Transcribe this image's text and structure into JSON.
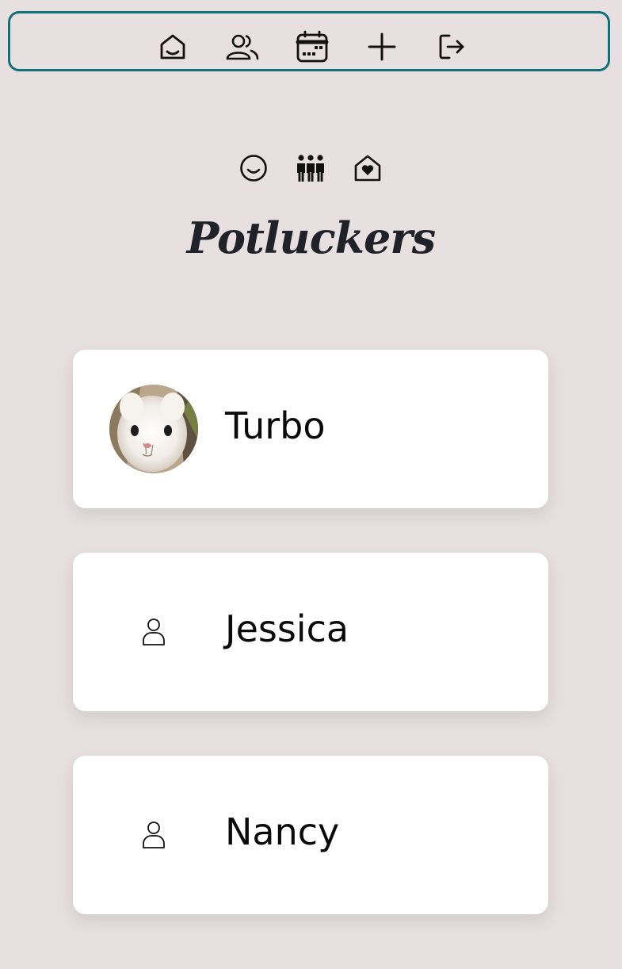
{
  "nav": {
    "items": [
      {
        "icon": "home-icon"
      },
      {
        "icon": "users-icon"
      },
      {
        "icon": "calendar-icon"
      },
      {
        "icon": "plus-icon"
      },
      {
        "icon": "logout-icon"
      }
    ],
    "border_color": "#12727a"
  },
  "header": {
    "icons": [
      "smile-icon",
      "people-group-icon",
      "house-heart-icon"
    ],
    "title": "Potluckers"
  },
  "members": [
    {
      "name": "Turbo",
      "avatar": "bunny-photo"
    },
    {
      "name": "Jessica",
      "avatar": "person-icon"
    },
    {
      "name": "Nancy",
      "avatar": "person-icon"
    }
  ],
  "colors": {
    "background": "#e8e0e0",
    "card": "#ffffff",
    "accent": "#12727a"
  }
}
